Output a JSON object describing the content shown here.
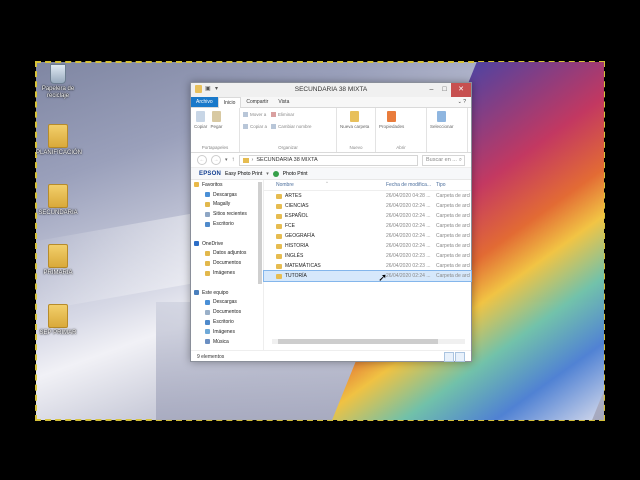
{
  "desktop": {
    "icons": [
      {
        "label": "Papelera de reciclaje",
        "kind": "bin"
      },
      {
        "label": "PLANIFICACIÓN",
        "kind": "folder"
      },
      {
        "label": "SECUNDARIA",
        "kind": "folder"
      },
      {
        "label": "PRIMARIA",
        "kind": "folder"
      },
      {
        "label": "SEP PRIMAR",
        "kind": "folder"
      }
    ]
  },
  "window": {
    "title": "SECUNDARIA 38 MIXTA",
    "buttons": {
      "minimize": "–",
      "maximize": "□",
      "close": "✕"
    },
    "tabs": [
      "Archivo",
      "Inicio",
      "Compartir",
      "Vista"
    ],
    "active_tab": "Inicio",
    "ribbon": {
      "groups": [
        {
          "name": "Portapapeles",
          "big": [
            "Copiar",
            "Pegar"
          ]
        },
        {
          "name": "Organizar",
          "small": [
            "Mover a",
            "Copiar a",
            "Eliminar",
            "Cambiar nombre"
          ]
        },
        {
          "name": "Nuevo",
          "big": [
            "Nueva carpeta"
          ]
        },
        {
          "name": "Abrir",
          "big": [
            "Propiedades"
          ]
        },
        {
          "name": "",
          "big": [
            "Seleccionar"
          ]
        }
      ]
    },
    "address": {
      "path": "SECUNDARIA 38 MIXTA",
      "search_placeholder": "Buscar en ..."
    },
    "epson": {
      "brand": "EPSON",
      "item1": "Easy Photo Print",
      "item2": "Photo Print"
    },
    "navpane": [
      {
        "label": "Favoritos",
        "level": 0,
        "color": "#e9b949"
      },
      {
        "label": "Descargas",
        "level": 1,
        "color": "#4a8fd6"
      },
      {
        "label": "Magally",
        "level": 1,
        "color": "#e2b84c"
      },
      {
        "label": "Sitios recientes",
        "level": 1,
        "color": "#8ea6c4"
      },
      {
        "label": "Escritorio",
        "level": 1,
        "color": "#4f8acb"
      },
      {
        "label": "",
        "level": 0,
        "color": ""
      },
      {
        "label": "OneDrive",
        "level": 0,
        "color": "#2d6ec7"
      },
      {
        "label": "Datos adjuntos",
        "level": 1,
        "color": "#e2b84c"
      },
      {
        "label": "Documentos",
        "level": 1,
        "color": "#e2b84c"
      },
      {
        "label": "Imágenes",
        "level": 1,
        "color": "#e2b84c"
      },
      {
        "label": "",
        "level": 0,
        "color": ""
      },
      {
        "label": "Este equipo",
        "level": 0,
        "color": "#4a7fbd"
      },
      {
        "label": "Descargas",
        "level": 1,
        "color": "#4a8fd6"
      },
      {
        "label": "Documentos",
        "level": 1,
        "color": "#9ab0c8"
      },
      {
        "label": "Escritorio",
        "level": 1,
        "color": "#4f8acb"
      },
      {
        "label": "Imágenes",
        "level": 1,
        "color": "#6fa9d8"
      },
      {
        "label": "Música",
        "level": 1,
        "color": "#6b8fc2"
      }
    ],
    "columns": {
      "name": "Nombre",
      "date": "Fecha de modifica...",
      "type": "Tipo"
    },
    "files": [
      {
        "name": "ARTES",
        "date": "26/04/2020 04:28 ...",
        "type": "Carpeta de arcl"
      },
      {
        "name": "CIENCIAS",
        "date": "26/04/2020 02:24 ...",
        "type": "Carpeta de arcl"
      },
      {
        "name": "ESPAÑOL",
        "date": "26/04/2020 02:24 ...",
        "type": "Carpeta de arcl"
      },
      {
        "name": "FCE",
        "date": "26/04/2020 02:24 ...",
        "type": "Carpeta de arcl"
      },
      {
        "name": "GEOGRAFÍA",
        "date": "26/04/2020 02:24 ...",
        "type": "Carpeta de arcl"
      },
      {
        "name": "HISTORIA",
        "date": "26/04/2020 02:24 ...",
        "type": "Carpeta de arcl"
      },
      {
        "name": "INGLÉS",
        "date": "26/04/2020 02:23 ...",
        "type": "Carpeta de arcl"
      },
      {
        "name": "MATEMÁTICAS",
        "date": "26/04/2020 02:23 ...",
        "type": "Carpeta de arcl"
      },
      {
        "name": "TUTORÍA",
        "date": "26/04/2020 02:24 ...",
        "type": "Carpeta de arcl",
        "selected": true
      }
    ],
    "status": "9 elementos"
  }
}
